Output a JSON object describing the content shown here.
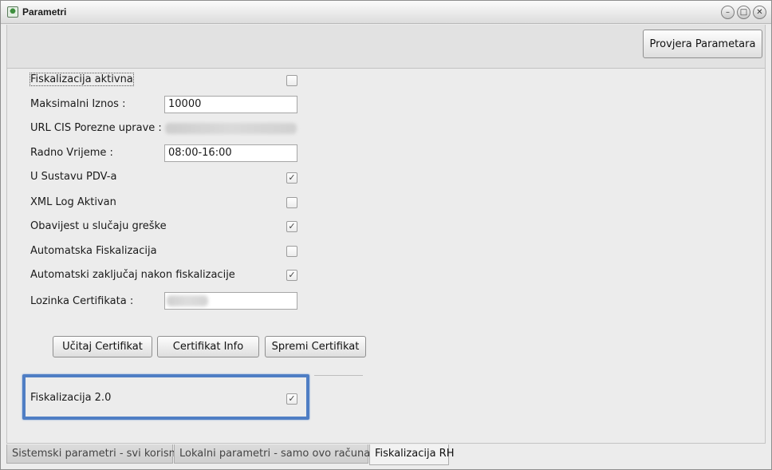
{
  "window": {
    "title": "Parametri",
    "icon": "app-icon",
    "controls": [
      "minimize-icon",
      "maximize-icon",
      "close-icon"
    ]
  },
  "toolbar": {
    "check_label": "Provjera Parametara"
  },
  "form": {
    "fiskalizacija_aktivna": {
      "label": "Fiskalizacija aktivna",
      "checked": false
    },
    "max_iznos": {
      "label": "Maksimalni Iznos :",
      "value": "10000"
    },
    "url_cis": {
      "label": "URL CIS Porezne uprave :"
    },
    "radno_vrijeme": {
      "label": "Radno Vrijeme :",
      "value": "08:00-16:00"
    },
    "u_sustavu_pdv": {
      "label": "U Sustavu PDV-a",
      "checked": true
    },
    "xml_log": {
      "label": "XML Log Aktivan",
      "checked": false
    },
    "obavijest": {
      "label": "Obavijest u slučaju greške",
      "checked": true
    },
    "auto_fisk": {
      "label": "Automatska Fiskalizacija",
      "checked": false
    },
    "auto_lock": {
      "label": "Automatski zaključaj nakon fiskalizacije",
      "checked": true
    },
    "lozinka": {
      "label": "Lozinka Certifikata :"
    },
    "fisk2": {
      "label": "Fiskalizacija 2.0",
      "checked": true
    }
  },
  "buttons": {
    "ucitaj": "Učitaj Certifikat",
    "info": "Certifikat Info",
    "spremi": "Spremi Certifikat"
  },
  "tabs": [
    {
      "label": "Sistemski parametri - svi korisnici",
      "active": false
    },
    {
      "label": "Lokalni parametri - samo ovo računalo",
      "active": false
    },
    {
      "label": "Fiskalizacija RH",
      "active": true
    }
  ],
  "colors": {
    "highlight": "#4f7ec4",
    "background": "#ececec"
  },
  "glyphs": {
    "check": "✓",
    "minimize": "–",
    "maximize": "□",
    "close": "✕"
  }
}
